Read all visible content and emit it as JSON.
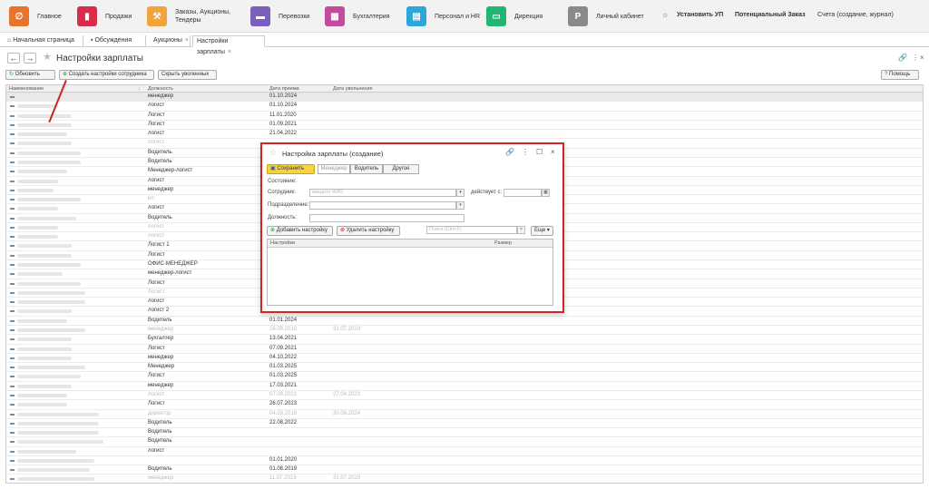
{
  "sections": [
    {
      "label": "Главное",
      "icon": "logo-icon",
      "color": "#e8742b"
    },
    {
      "label": "Продажи",
      "icon": "chart-icon",
      "color": "#d92b4a"
    },
    {
      "label": "Заказы, Аукционы, Тендеры",
      "icon": "gavel-icon",
      "color": "#f2a43a"
    },
    {
      "label": "Перевозки",
      "icon": "truck-icon",
      "color": "#7a5fbf"
    },
    {
      "label": "Бухгалтерия",
      "icon": "calculator-icon",
      "color": "#c44a9e"
    },
    {
      "label": "Персонал и HR",
      "icon": "id-card-icon",
      "color": "#2aa8dc"
    },
    {
      "label": "Дирекция",
      "icon": "folder-icon",
      "color": "#22b573"
    },
    {
      "label": "Личный кабинет",
      "icon": "parking-icon",
      "color": "#8a8a8a"
    }
  ],
  "top_right": {
    "star": "☆",
    "install": "Установить УП",
    "potential": "Потенциальный Заказ",
    "accounts": "Счета (создание, журнал)"
  },
  "tabs": [
    {
      "label": "Начальная страница",
      "icon": "home-icon"
    },
    {
      "label": "Обсуждения",
      "icon": "chat-icon"
    },
    {
      "label": "Аукционы",
      "close": "×"
    },
    {
      "label": "Настройки зарплаты",
      "close": "×"
    }
  ],
  "page_title": "Настройки зарплаты",
  "toolbar": {
    "refresh": "Обновить",
    "create": "Создать настройки сотрудника",
    "hide": "Скрыть уволенных",
    "help": "Помощь"
  },
  "grid": {
    "headers": [
      "Наименование",
      "Должность",
      "Дата приема",
      "Дата увольнения"
    ],
    "rows": [
      {
        "pos": "менеджер",
        "hire": "01.10.2024",
        "fire": "",
        "dim": false,
        "sel": true
      },
      {
        "pos": "логист",
        "hire": "01.10.2024",
        "fire": "",
        "dim": false
      },
      {
        "pos": "Логист",
        "hire": "11.01.2020",
        "fire": "",
        "dim": false
      },
      {
        "pos": "Логист",
        "hire": "01.09.2021",
        "fire": "",
        "dim": false
      },
      {
        "pos": "логист",
        "hire": "21.04.2022",
        "fire": "",
        "dim": false
      },
      {
        "pos": "логист",
        "hire": "",
        "fire": "",
        "dim": true
      },
      {
        "pos": "Водитель",
        "hire": "",
        "fire": "",
        "dim": false
      },
      {
        "pos": "Водитель",
        "hire": "",
        "fire": "",
        "dim": false
      },
      {
        "pos": "Менеджер-логист",
        "hire": "",
        "fire": "",
        "dim": false
      },
      {
        "pos": "логист",
        "hire": "",
        "fire": "",
        "dim": false
      },
      {
        "pos": "менеджер",
        "hire": "",
        "fire": "",
        "dim": false
      },
      {
        "pos": "ил",
        "hire": "",
        "fire": "",
        "dim": true
      },
      {
        "pos": "логист",
        "hire": "",
        "fire": "",
        "dim": false
      },
      {
        "pos": "Водитель",
        "hire": "",
        "fire": "",
        "dim": false
      },
      {
        "pos": "логист",
        "hire": "",
        "fire": "",
        "dim": true
      },
      {
        "pos": "логист",
        "hire": "",
        "fire": "",
        "dim": true
      },
      {
        "pos": "Логист 1",
        "hire": "",
        "fire": "",
        "dim": false
      },
      {
        "pos": "Логист",
        "hire": "",
        "fire": "",
        "dim": false
      },
      {
        "pos": "ОФИС-МЕНЕДЖЕР",
        "hire": "",
        "fire": "",
        "dim": false
      },
      {
        "pos": "менеджер-логист",
        "hire": "",
        "fire": "",
        "dim": false
      },
      {
        "pos": "Логист",
        "hire": "",
        "fire": "",
        "dim": false
      },
      {
        "pos": "Логист",
        "hire": "",
        "fire": "",
        "dim": true
      },
      {
        "pos": "логист",
        "hire": "",
        "fire": "",
        "dim": false
      },
      {
        "pos": " логист 2",
        "hire": "",
        "fire": "",
        "dim": false
      },
      {
        "pos": "Водитель",
        "hire": "01.01.2024",
        "fire": "",
        "dim": false
      },
      {
        "pos": "менеджер",
        "hire": "26.09.2018",
        "fire": "31.07.2019",
        "dim": true
      },
      {
        "pos": "Бухгалтер",
        "hire": "13.04.2021",
        "fire": "",
        "dim": false
      },
      {
        "pos": "Логист",
        "hire": "07.09.2021",
        "fire": "",
        "dim": false
      },
      {
        "pos": "менеджер",
        "hire": "04.10.2022",
        "fire": "",
        "dim": false
      },
      {
        "pos": "Менеджер",
        "hire": "01.03.2025",
        "fire": "",
        "dim": false
      },
      {
        "pos": "Логист",
        "hire": "01.03.2025",
        "fire": "",
        "dim": false
      },
      {
        "pos": "менеджер",
        "hire": "17.03.2021",
        "fire": "",
        "dim": false
      },
      {
        "pos": "логист",
        "hire": "07.09.2021",
        "fire": "27.04.2023",
        "dim": true
      },
      {
        "pos": "Логист",
        "hire": "26.07.2023",
        "fire": "",
        "dim": false
      },
      {
        "pos": "директор",
        "hire": "04.09.2018",
        "fire": "30.09.2024",
        "dim": true
      },
      {
        "pos": "Водитель",
        "hire": "22.08.2022",
        "fire": "",
        "dim": false
      },
      {
        "pos": "Водитель",
        "hire": "",
        "fire": "",
        "dim": false
      },
      {
        "pos": "Водитель",
        "hire": "",
        "fire": "",
        "dim": false
      },
      {
        "pos": "логист",
        "hire": "",
        "fire": "",
        "dim": false
      },
      {
        "pos": "",
        "hire": "01.01.2020",
        "fire": "",
        "dim": false
      },
      {
        "pos": "Водитель",
        "hire": "01.08.2019",
        "fire": "",
        "dim": false
      },
      {
        "pos": "менеджер",
        "hire": "11.07.2019",
        "fire": "31.07.2019",
        "dim": true
      }
    ]
  },
  "modal": {
    "title": "Настройка зарплаты (создание)",
    "save": "Сохранить",
    "tabs": [
      "Менеджер",
      "Водитель",
      "Другое"
    ],
    "state_label": "Состояние:",
    "employee_label": "Сотрудник:",
    "employee_placeholder": "введите ФИО",
    "valid_from_label": "действует с:",
    "date_placeholder": ". .",
    "department_label": "Подразделение:",
    "position_label": "Должность:",
    "add_setting": "Добавить настройку",
    "delete_setting": "Удалить настройку",
    "search_placeholder": "Поиск (Ctrl+F)",
    "more": "Еще",
    "table_headers": [
      "Настройки",
      "Размер"
    ]
  }
}
